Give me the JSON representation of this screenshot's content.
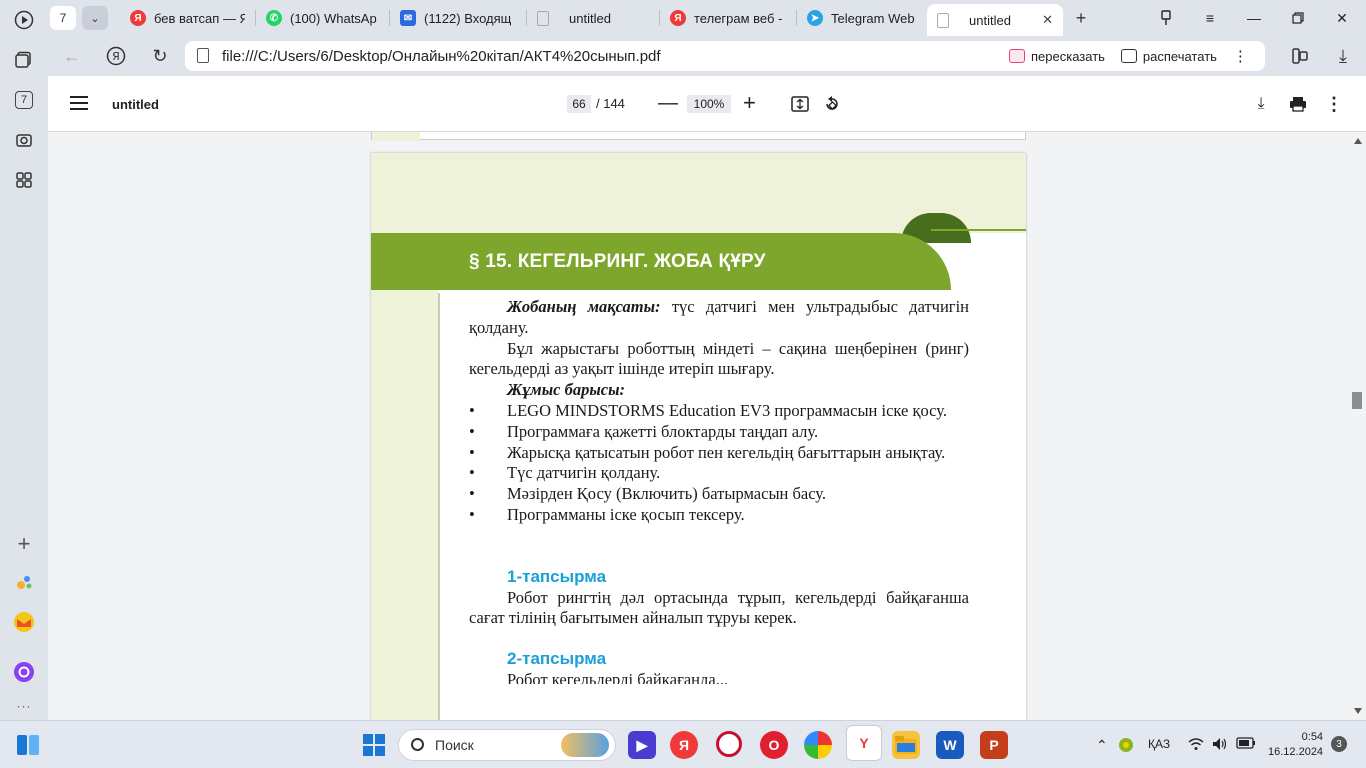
{
  "browser": {
    "tab_count": "7",
    "tabs": [
      {
        "label": "бев ватсап — Я",
        "favicon_color": "#f03a3a",
        "favicon": "Я"
      },
      {
        "label": "(100) WhatsAp",
        "favicon_color": "#25d366",
        "favicon": "✆"
      },
      {
        "label": "(1122) Входящ",
        "favicon_color": "#2d6ae0",
        "favicon": "✉"
      },
      {
        "label": "untitled",
        "favicon_color": "#c8ccd2",
        "favicon": ""
      },
      {
        "label": "телеграм веб -",
        "favicon_color": "#f03a3a",
        "favicon": "Я"
      },
      {
        "label": "Telegram Web",
        "favicon_color": "#2aa3e0",
        "favicon": "➤"
      },
      {
        "label": "untitled",
        "favicon_color": "#c8ccd2",
        "favicon": ""
      }
    ],
    "url": "file:///C:/Users/6/Desktop/Онлайын%20кітап/АКТ4%20сынып.pdf",
    "retell_label": "пересказать",
    "print_label": "распечатать",
    "sidebar_badge": "7"
  },
  "pdf": {
    "title": "untitled",
    "current_page": "66",
    "total_pages": "/ 144",
    "zoom": "100%"
  },
  "page": {
    "heading": "§ 15. КЕГЕЛЬРИНГ. ЖОБА ҚҰРУ",
    "goal_label": "Жобаның мақсаты:",
    "goal_text": " түс датчигі мен ультрадыбыс датчигін қолдану.",
    "task_text": "Бұл жарыстағы роботтың міндеті – сақина шеңберінен (ринг) кегельдерді аз уақыт ішінде итеріп шығару.",
    "process_label": "Жұмыс барысы:",
    "steps": [
      "LEGO MINDSTORMS Education EV3 программасын іске қосу.",
      "Программаға қажетті блоктарды таңдап алу.",
      "Жарысқа қатысатын робот пен кегельдің бағыттарын анықтау.",
      "Түс датчигін қолдану.",
      "Мәзірден Қосу (Включить) батырмасын басу.",
      "Программаны іске қосып тексеру."
    ],
    "task1_title": "1-тапсырма",
    "task1_text": "Робот рингтің дәл ортасында тұрып, кегельдерді байқағанша сағат тілінің бағытымен айналып тұруы керек.",
    "task2_title": "2-тапсырма",
    "task2_text": "Робот кегельдерді байқағанда..."
  },
  "taskbar": {
    "search_placeholder": "Поиск",
    "language": "ҚАЗ",
    "time": "0:54",
    "date": "16.12.2024",
    "notifications": "3"
  },
  "colors": {
    "banner_green": "#7ea52c",
    "task_blue": "#1ba0d8",
    "page_tint": "#eef2d8"
  }
}
